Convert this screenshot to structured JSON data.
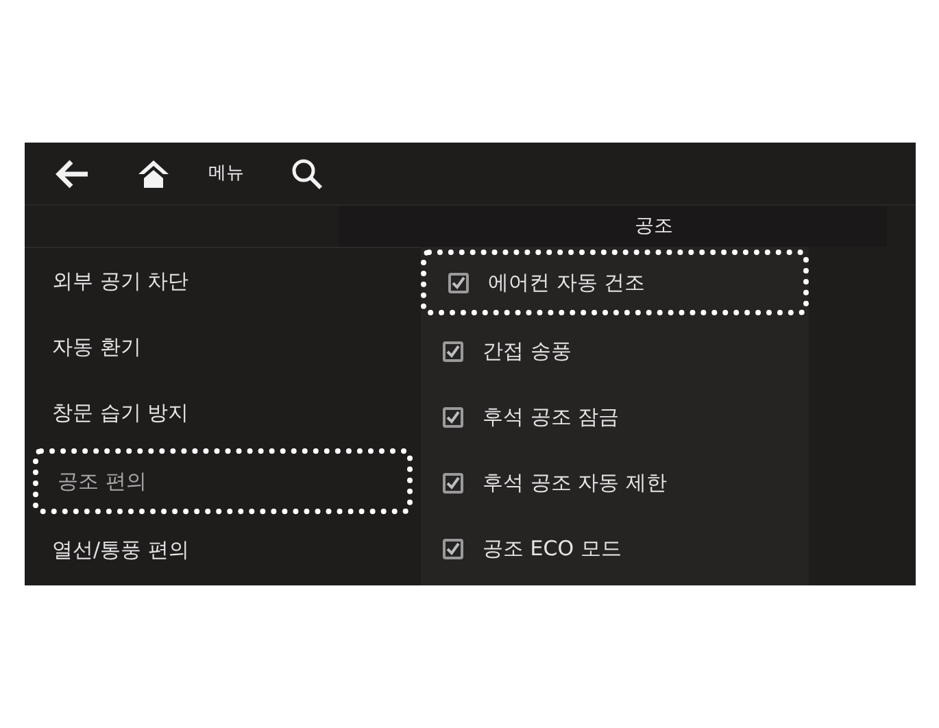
{
  "top_bar": {
    "menu_label": "메뉴"
  },
  "header": {
    "title": "공조"
  },
  "menu_items": [
    {
      "label": "외부 공기 차단",
      "selected": false,
      "highlighted": false
    },
    {
      "label": "자동 환기",
      "selected": false,
      "highlighted": false
    },
    {
      "label": "창문 습기 방지",
      "selected": false,
      "highlighted": false
    },
    {
      "label": "공조 편의",
      "selected": true,
      "highlighted": true
    },
    {
      "label": "열선/통풍 편의",
      "selected": false,
      "highlighted": false
    }
  ],
  "options": [
    {
      "label": "에어컨 자동 건조",
      "checked": true,
      "highlighted": true
    },
    {
      "label": "간접 송풍",
      "checked": true,
      "highlighted": false
    },
    {
      "label": "후석 공조 잠금",
      "checked": true,
      "highlighted": false
    },
    {
      "label": "후석 공조 자동 제한",
      "checked": true,
      "highlighted": false
    },
    {
      "label": "공조 ECO 모드",
      "checked": true,
      "highlighted": false
    }
  ]
}
